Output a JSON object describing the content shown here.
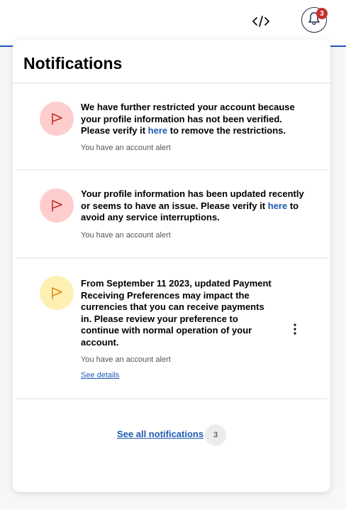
{
  "header": {
    "dev_icon": "code-icon",
    "bell_icon": "bell-icon",
    "bell_badge": "3"
  },
  "panel": {
    "title": "Notifications",
    "notifications": [
      {
        "icon": "flag-icon",
        "icon_bg": "#fecece",
        "icon_color": "#c4302b",
        "text_before": "We have further restricted your account because your profile information has not been verified. Please verify it ",
        "link": "here",
        "text_after": " to remove the restrictions.",
        "meta": "You have an account alert"
      },
      {
        "icon": "flag-icon",
        "icon_bg": "#fecece",
        "icon_color": "#c4302b",
        "text_before": "Your profile information has been updated recently or seems to have an issue. Please verify it ",
        "link": "here",
        "text_after": " to avoid any service interruptions.",
        "meta": "You have an account alert"
      },
      {
        "icon": "flag-icon",
        "icon_bg": "#fdf0b2",
        "icon_color": "#e08a1e",
        "text": "From September 11 2023, updated Payment Receiving Preferences may impact the currencies that you can receive payments in. Please review your preference to continue with normal operation of your account.",
        "meta": "You have an account alert",
        "details_label": "See details",
        "menu_icon": "kebab-menu-icon"
      }
    ],
    "see_all_label": "See all notifications",
    "see_all_count": "3"
  },
  "colors": {
    "accent": "#1f5bb5",
    "alert_red": "#c4302b"
  }
}
